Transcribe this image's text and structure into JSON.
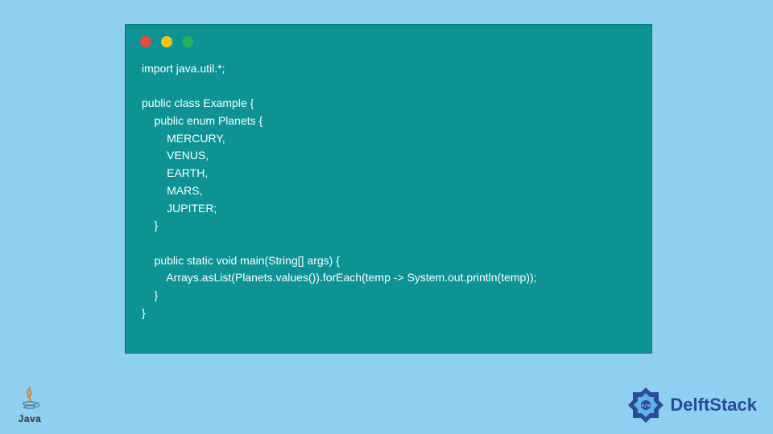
{
  "window": {
    "dots": [
      "red",
      "yellow",
      "green"
    ]
  },
  "code": {
    "lines": [
      "import java.util.*;",
      "",
      "public class Example {",
      "    public enum Planets {",
      "        MERCURY,",
      "        VENUS,",
      "        EARTH,",
      "        MARS,",
      "        JUPITER;",
      "    }",
      "",
      "    public static void main(String[] args) {",
      "        Arrays.asList(Planets.values()).forEach(temp -> System.out.println(temp));",
      "    }",
      "}"
    ]
  },
  "footer": {
    "java_label": "Java",
    "brand": "DelftStack"
  },
  "colors": {
    "page_bg": "#8fcff0",
    "window_bg": "#0d9394",
    "code_text": "#ffffff",
    "brand_text": "#2b4a9b"
  }
}
